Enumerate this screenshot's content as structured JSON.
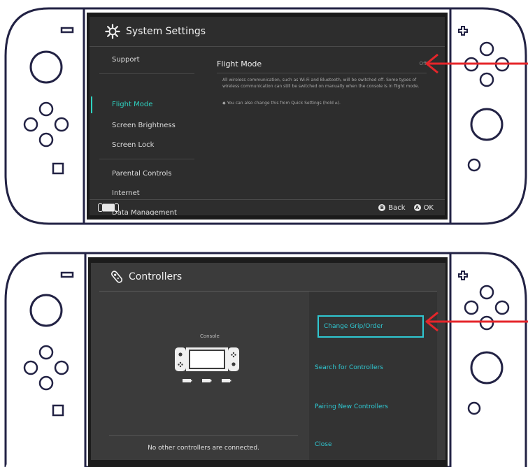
{
  "system_settings": {
    "title": "System Settings",
    "nav": [
      {
        "label": "Support",
        "selected": false
      },
      {
        "label": "Flight Mode",
        "selected": true
      },
      {
        "label": "Screen Brightness",
        "selected": false
      },
      {
        "label": "Screen Lock",
        "selected": false
      },
      {
        "label": "Parental Controls",
        "selected": false
      },
      {
        "label": "Internet",
        "selected": false
      },
      {
        "label": "Data Management",
        "selected": false
      }
    ],
    "flight_mode": {
      "label": "Flight Mode",
      "value": "Off",
      "description": "All wireless communication, such as Wi-Fi and Bluetooth, will be switched off. Some types of wireless communication can still be switched on manually when the console is in flight mode.",
      "tip": "◆ You can also change this from Quick Settings (hold ⌂)."
    },
    "footer": {
      "back_key": "B",
      "back_label": "Back",
      "ok_key": "A",
      "ok_label": "OK"
    }
  },
  "controllers": {
    "title": "Controllers",
    "console_label": "Console",
    "no_controllers_text": "No other controllers are connected.",
    "options": [
      {
        "label": "Change Grip/Order",
        "selected": true
      },
      {
        "label": "Search for Controllers",
        "selected": false
      },
      {
        "label": "Pairing New Controllers",
        "selected": false
      },
      {
        "label": "Close",
        "selected": false
      }
    ]
  },
  "colors": {
    "accent": "#2fd3c1",
    "arrow": "#e5252a",
    "outline": "#222244"
  }
}
